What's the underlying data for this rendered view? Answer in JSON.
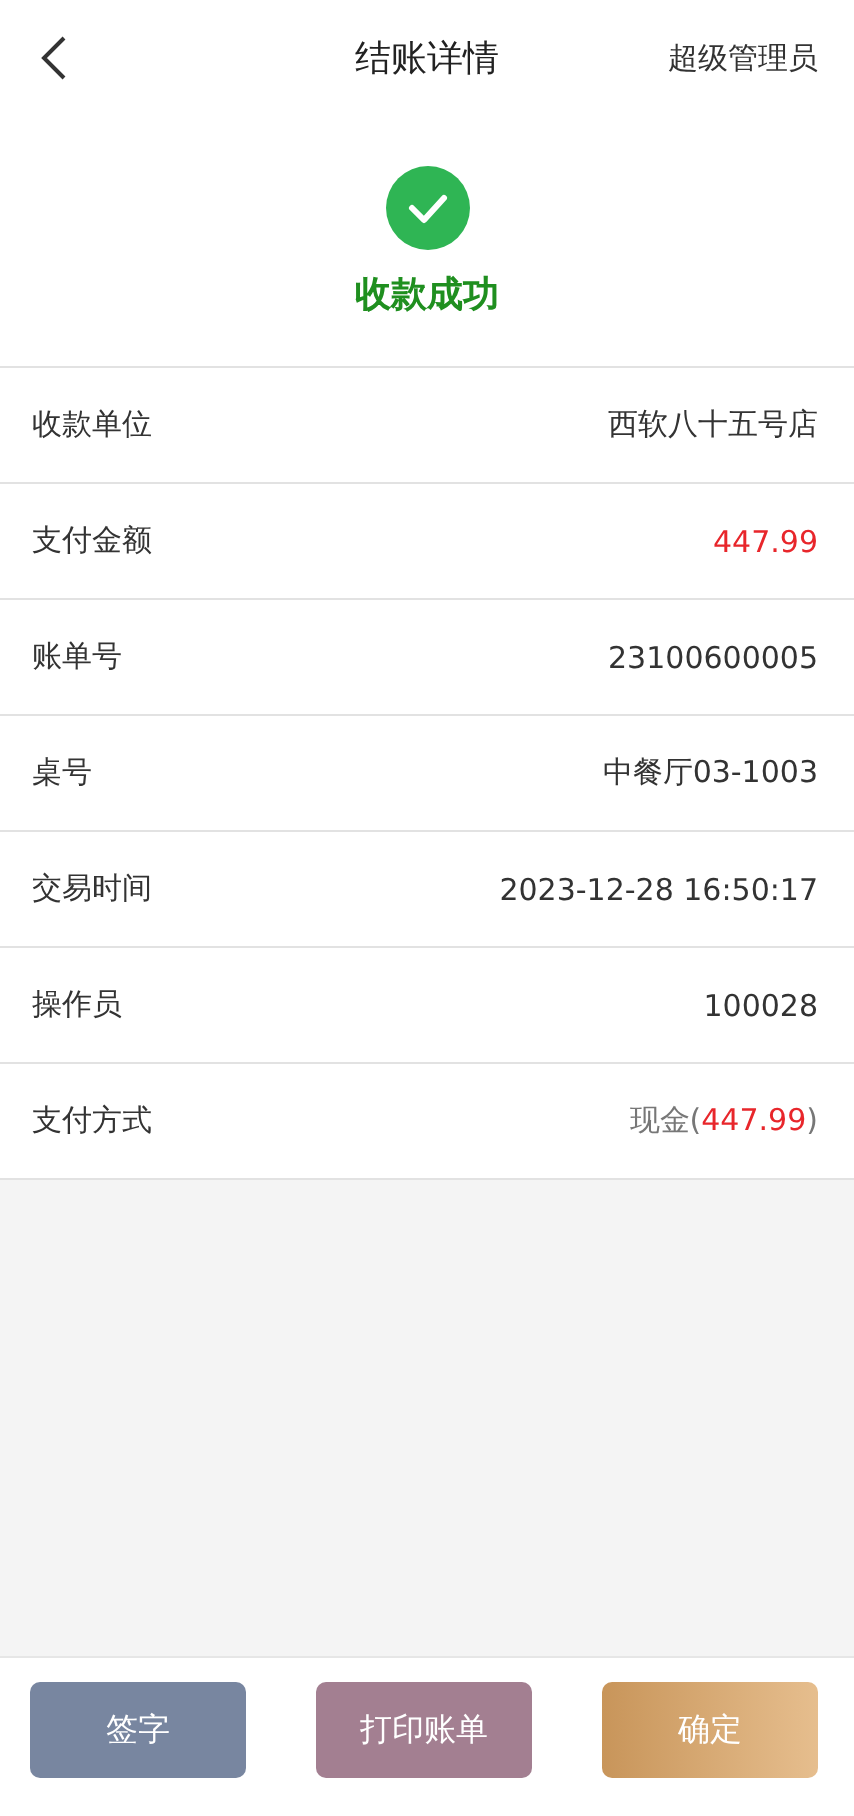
{
  "header": {
    "title": "结账详情",
    "user": "超级管理员"
  },
  "status": {
    "text": "收款成功",
    "success": true
  },
  "rows": [
    {
      "label": "收款单位",
      "value": [
        {
          "text": "西软八十五号店",
          "highlight": false
        }
      ]
    },
    {
      "label": "支付金额",
      "value": [
        {
          "text": "447.99",
          "highlight": true
        }
      ]
    },
    {
      "label": "账单号",
      "value": [
        {
          "text": "23100600005",
          "highlight": false
        }
      ]
    },
    {
      "label": "桌号",
      "value": [
        {
          "text": "中餐厅03-1003",
          "highlight": false
        }
      ]
    },
    {
      "label": "交易时间",
      "value": [
        {
          "text": "2023-12-28 16:50:17",
          "highlight": false
        }
      ]
    },
    {
      "label": "操作员",
      "value": [
        {
          "text": "100028",
          "highlight": false
        }
      ]
    },
    {
      "label": "支付方式",
      "value": [
        {
          "text": "现金(",
          "highlight": false,
          "muted": true
        },
        {
          "text": "447.99",
          "highlight": true
        },
        {
          "text": ")",
          "highlight": false,
          "muted": true
        }
      ]
    }
  ],
  "buttons": [
    {
      "label": "签字",
      "color": "#7886a0",
      "kind": "plain"
    },
    {
      "label": "打印账单",
      "color": "#a37f91",
      "kind": "plain"
    },
    {
      "label": "确定",
      "color": "#c8955a",
      "kind": "gradient"
    }
  ]
}
